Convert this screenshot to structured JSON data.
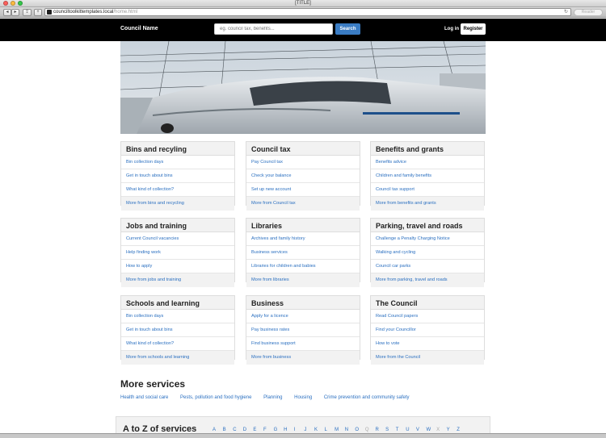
{
  "browser": {
    "title": "[TITLE]",
    "url_host": "counciltoolkittemplates.local",
    "url_path": "/home.html",
    "reader": "Reader"
  },
  "header": {
    "brand": "Council Name",
    "search_placeholder": "eg. council tax, benefits...",
    "search_button": "Search",
    "login": "Log in",
    "register": "Register"
  },
  "cards": [
    {
      "title": "Bins and recyling",
      "links": [
        "Bin collection days",
        "Get in touch about bins",
        "What kind of collection?"
      ],
      "more": "More from bins and recycling"
    },
    {
      "title": "Council tax",
      "links": [
        "Pay Council tax",
        "Check your balance",
        "Set up new account"
      ],
      "more": "More from Council tax"
    },
    {
      "title": "Benefits and grants",
      "links": [
        "Benefits advice",
        "Children and family benefits",
        "Council tax support"
      ],
      "more": "More from benefits and grants"
    },
    {
      "title": "Jobs and training",
      "links": [
        "Current Council vacancies",
        "Help finding work",
        "How to apply"
      ],
      "more": "More from jobs and training"
    },
    {
      "title": "Libraries",
      "links": [
        "Archives and family history",
        "Business services",
        "Libraries for children and babies"
      ],
      "more": "More from libraries"
    },
    {
      "title": "Parking, travel and roads",
      "links": [
        "Challenge a Penalty Charging Notice",
        "Walking and cycling",
        "Council car parks"
      ],
      "more": "More from parking, travel and roads"
    },
    {
      "title": "Schools and learning",
      "links": [
        "Bin collection days",
        "Get in touch about bins",
        "What kind of collection?"
      ],
      "more": "More from schools and learning"
    },
    {
      "title": "Business",
      "links": [
        "Apply for a licence",
        "Pay business rates",
        "Find business support"
      ],
      "more": "More from business"
    },
    {
      "title": "The Council",
      "links": [
        "Read Council papers",
        "Find your Councillor",
        "How to vote"
      ],
      "more": "More from the Council"
    }
  ],
  "more_services": {
    "title": "More services",
    "items": [
      "Health and social care",
      "Pests, pollution and food hygiene",
      "Planning",
      "Housing",
      "Crime prevention and community safety"
    ]
  },
  "atoz": {
    "title": "A to Z of services",
    "letters": [
      "A",
      "B",
      "C",
      "D",
      "E",
      "F",
      "G",
      "H",
      "I",
      "J",
      "K",
      "L",
      "M",
      "N",
      "O",
      "Q",
      "R",
      "S",
      "T",
      "U",
      "V",
      "W",
      "X",
      "Y",
      "Z"
    ],
    "disabled": [
      "Q",
      "X"
    ]
  }
}
